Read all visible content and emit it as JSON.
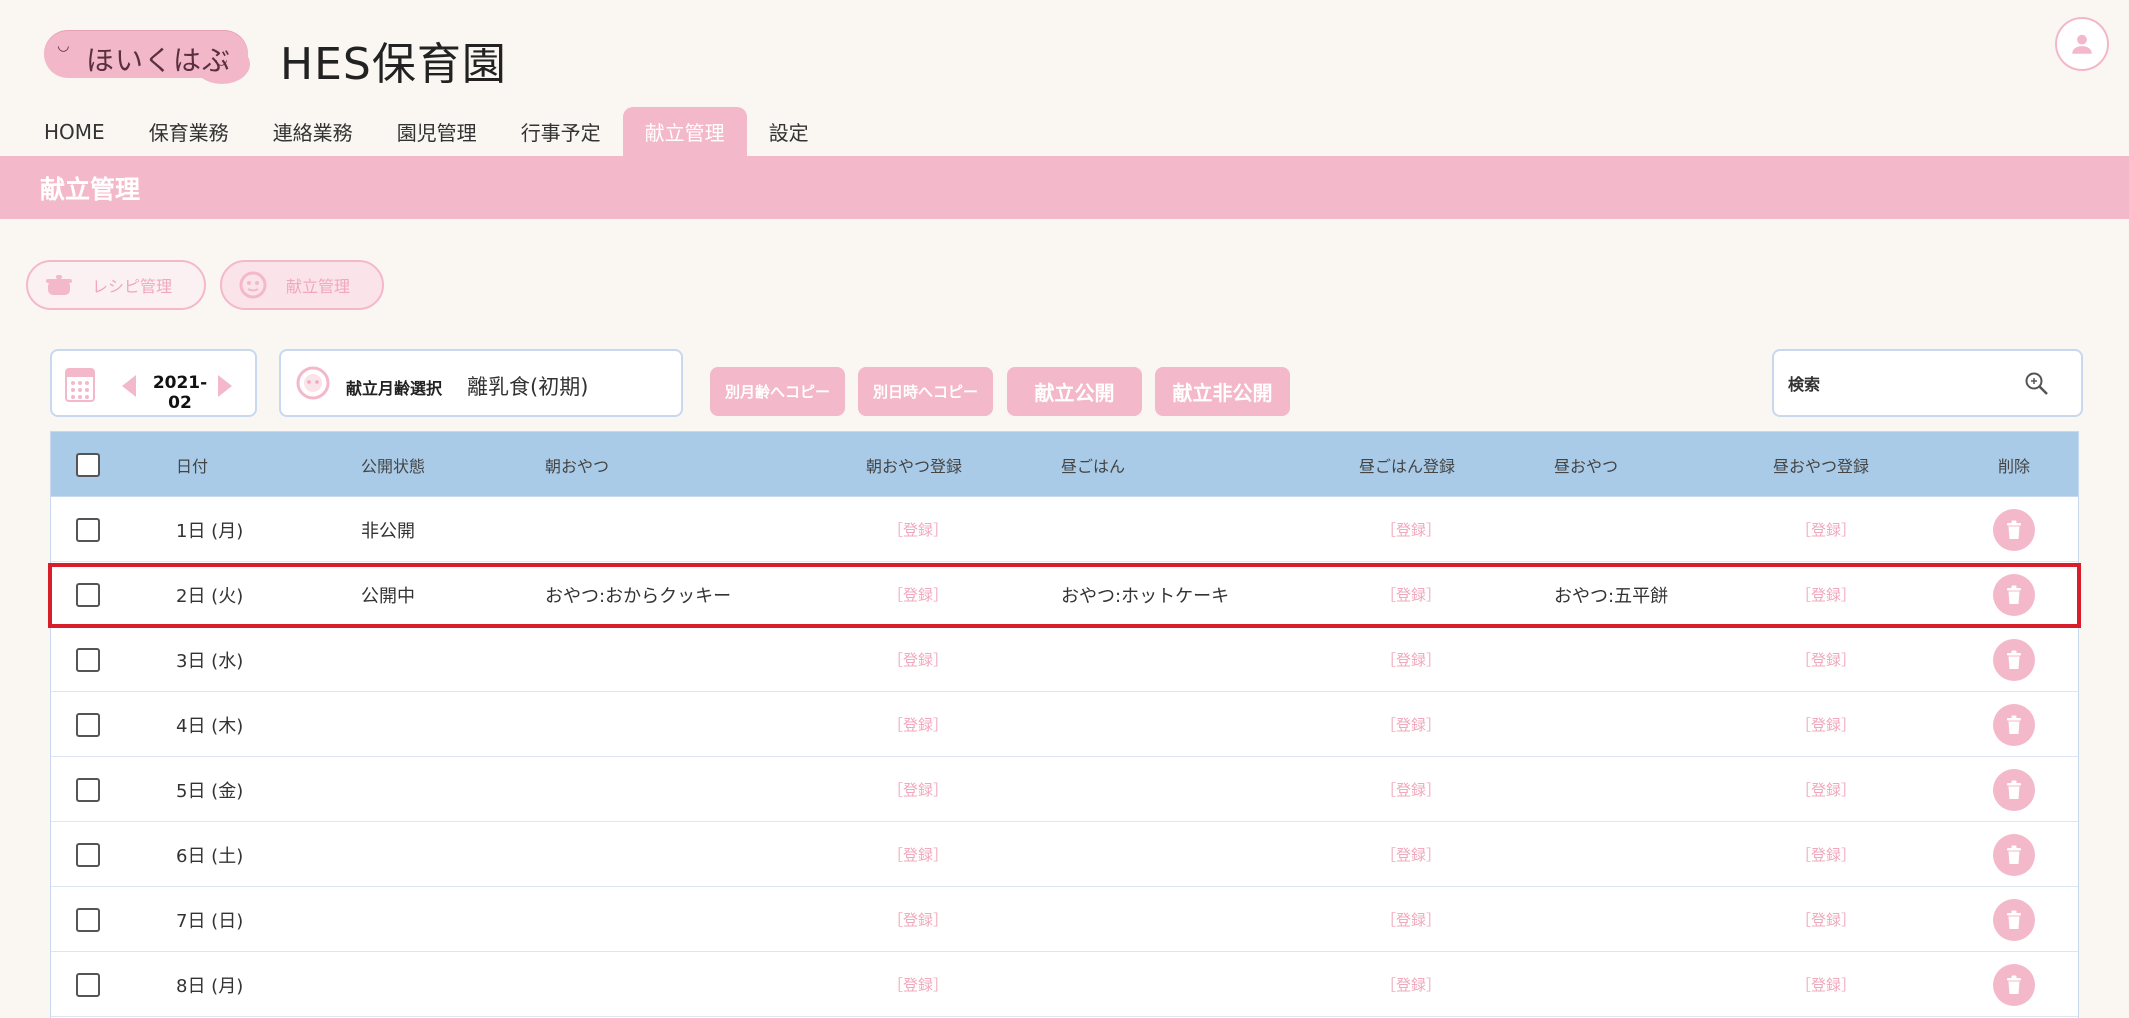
{
  "header": {
    "logo_text": "ほいくはぶ",
    "app_title": "HES保育園"
  },
  "nav": {
    "items": [
      {
        "label": "HOME",
        "active": false
      },
      {
        "label": "保育業務",
        "active": false
      },
      {
        "label": "連絡業務",
        "active": false
      },
      {
        "label": "園児管理",
        "active": false
      },
      {
        "label": "行事予定",
        "active": false
      },
      {
        "label": "献立管理",
        "active": true
      },
      {
        "label": "設定",
        "active": false
      }
    ]
  },
  "page": {
    "title": "献立管理"
  },
  "subnav": {
    "recipe_label": "レシピ管理",
    "menu_label": "献立管理"
  },
  "controls": {
    "month": "2021-02",
    "age_label": "献立月齢選択",
    "age_value": "離乳食(初期)",
    "copy_age": "別月齢へコピー",
    "copy_date": "別日時へコピー",
    "publish": "献立公開",
    "unpublish": "献立非公開",
    "search_placeholder": "検索"
  },
  "table": {
    "headers": [
      "日付",
      "公開状態",
      "朝おやつ",
      "朝おやつ登録",
      "昼ごはん",
      "昼ごはん登録",
      "昼おやつ",
      "昼おやつ登録",
      "削除"
    ],
    "register_label": "［登録］",
    "rows": [
      {
        "date": "1日 (月)",
        "status": "非公開",
        "morning": "",
        "lunch": "",
        "afternoon": ""
      },
      {
        "date": "2日 (火)",
        "status": "公開中",
        "morning": "おやつ:おからクッキー",
        "lunch": "おやつ:ホットケーキ",
        "afternoon": "おやつ:五平餅"
      },
      {
        "date": "3日 (水)",
        "status": "",
        "morning": "",
        "lunch": "",
        "afternoon": ""
      },
      {
        "date": "4日 (木)",
        "status": "",
        "morning": "",
        "lunch": "",
        "afternoon": ""
      },
      {
        "date": "5日 (金)",
        "status": "",
        "morning": "",
        "lunch": "",
        "afternoon": ""
      },
      {
        "date": "6日 (土)",
        "status": "",
        "morning": "",
        "lunch": "",
        "afternoon": ""
      },
      {
        "date": "7日 (日)",
        "status": "",
        "morning": "",
        "lunch": "",
        "afternoon": ""
      },
      {
        "date": "8日 (月)",
        "status": "",
        "morning": "",
        "lunch": "",
        "afternoon": ""
      }
    ]
  },
  "colors": {
    "accent_pink": "#f4b8cb",
    "header_blue": "#a9cbe8",
    "highlight_red": "#d81e2a"
  }
}
